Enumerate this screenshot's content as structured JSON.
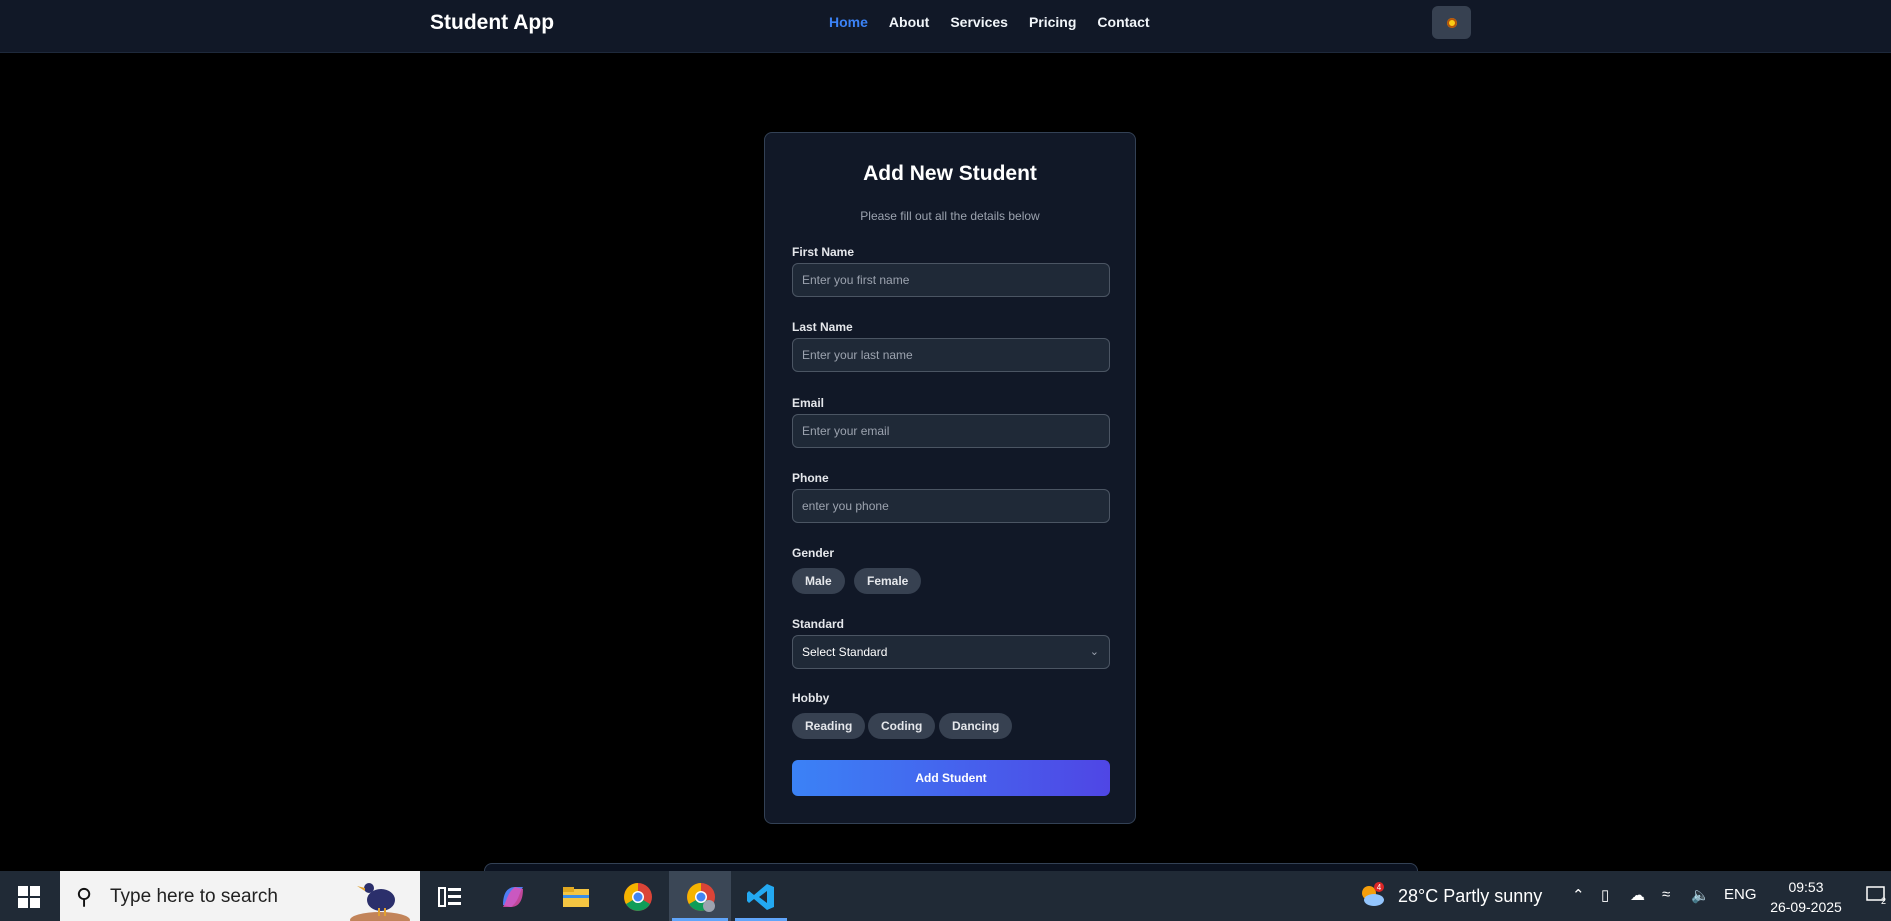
{
  "navbar": {
    "brand": "Student App",
    "links": [
      "Home",
      "About",
      "Services",
      "Pricing",
      "Contact"
    ],
    "active_link": "Home",
    "theme_toggle_icon": "sun-icon"
  },
  "form": {
    "title": "Add New Student",
    "subtitle": "Please fill out all the details below",
    "first_name": {
      "label": "First Name",
      "placeholder": "Enter you first name",
      "value": ""
    },
    "last_name": {
      "label": "Last Name",
      "placeholder": "Enter your last name",
      "value": ""
    },
    "email": {
      "label": "Email",
      "placeholder": "Enter your email",
      "value": ""
    },
    "phone": {
      "label": "Phone",
      "placeholder": "enter you phone",
      "value": ""
    },
    "gender": {
      "label": "Gender",
      "options": [
        "Male",
        "Female"
      ]
    },
    "standard": {
      "label": "Standard",
      "selected": "Select Standard"
    },
    "hobby": {
      "label": "Hobby",
      "options": [
        "Reading",
        "Coding",
        "Dancing"
      ]
    },
    "submit_label": "Add Student"
  },
  "taskbar": {
    "search_placeholder": "Type here to search",
    "weather": {
      "badge": "4",
      "text": "28°C  Partly sunny"
    },
    "language": "ENG",
    "time": "09:53",
    "date": "26-09-2025",
    "notification_count": "2",
    "apps": [
      "task-view-icon",
      "copilot-icon",
      "file-explorer-icon",
      "chrome-icon",
      "chrome-profile-icon",
      "vscode-icon"
    ]
  },
  "colors": {
    "accent": "#3b82f6",
    "button_gradient_start": "#3b82f6",
    "button_gradient_end": "#4f46e5",
    "card_bg": "#111827"
  }
}
